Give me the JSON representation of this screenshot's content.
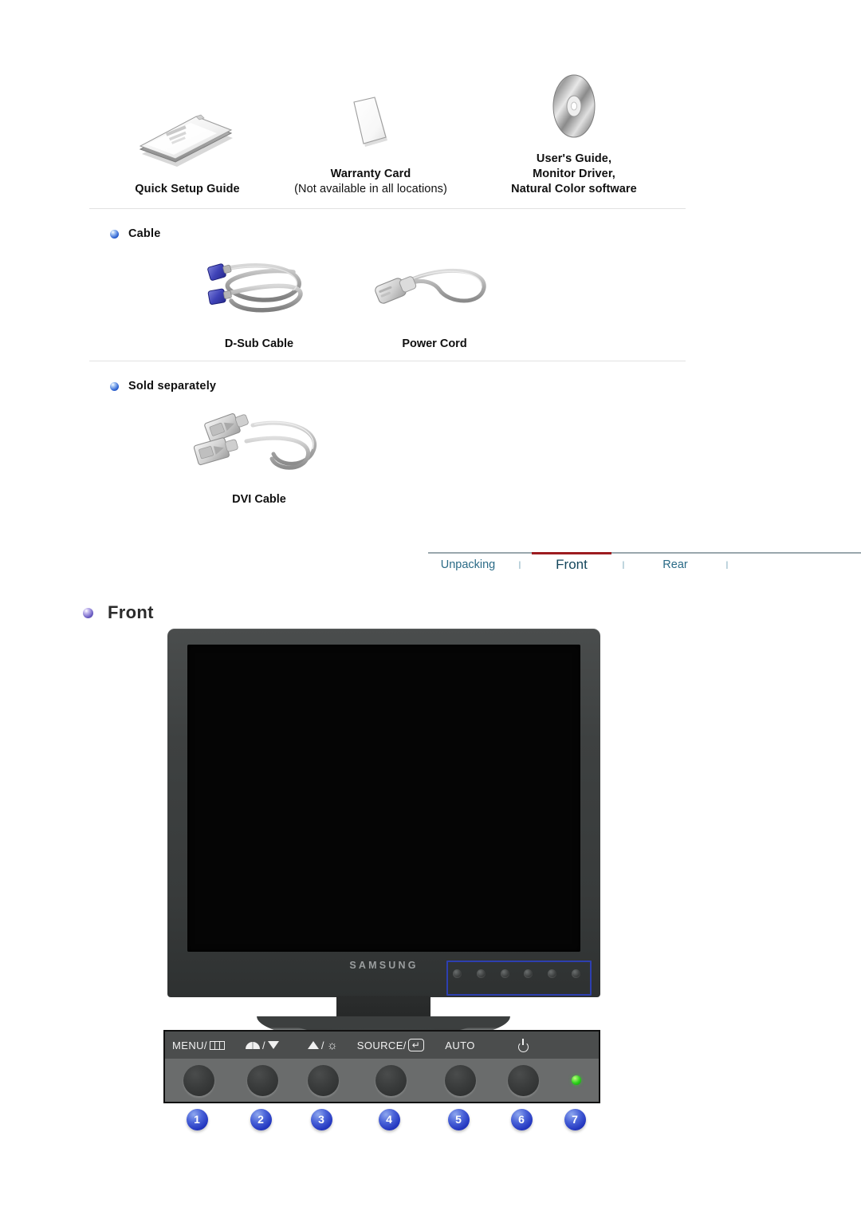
{
  "accessories": {
    "items": [
      {
        "icon": "manual-booklet-icon",
        "caption": "Quick Setup Guide",
        "sub": ""
      },
      {
        "icon": "warranty-card-icon",
        "caption": "Warranty Card",
        "sub": "(Not available in all locations)"
      },
      {
        "icon": "cd-disc-icon",
        "caption": "User's Guide,\nMonitor Driver,\nNatural Color software",
        "sub": ""
      }
    ],
    "item1_caption": "Quick Setup Guide",
    "item2_caption": "Warranty Card",
    "item2_sub": "(Not available in all locations)",
    "item3_line1": "User's Guide,",
    "item3_line2": "Monitor Driver,",
    "item3_line3": "Natural Color software"
  },
  "cable_section": {
    "heading": "Cable",
    "items": [
      {
        "icon": "d-sub-cable-icon",
        "caption": "D-Sub Cable"
      },
      {
        "icon": "power-cord-icon",
        "caption": "Power Cord"
      }
    ],
    "item1_caption": "D-Sub Cable",
    "item2_caption": "Power Cord"
  },
  "sold_separately_section": {
    "heading": "Sold separately",
    "item1_caption": "DVI Cable"
  },
  "tabnav": {
    "tabs": [
      {
        "label": "Unpacking",
        "active": false
      },
      {
        "label": "Front",
        "active": true
      },
      {
        "label": "Rear",
        "active": false
      }
    ],
    "tab1": "Unpacking",
    "tab2": "Front",
    "tab3": "Rear",
    "separator": "l",
    "active_color": "#9d1c20",
    "link_color": "#2b6b87"
  },
  "front_section": {
    "heading": "Front",
    "monitor": {
      "brand_logo": "SAMSUNG",
      "bezel_color": "#3e4141",
      "screen_color": "#050505",
      "highlight_color": "#2d3fb0"
    },
    "control_panel": {
      "buttons": [
        {
          "num": "1",
          "label": "MENU/",
          "icon": "menu-osd-icon"
        },
        {
          "num": "2",
          "label": "",
          "icon": "contrast-icon",
          "icon2": "triangle-down-icon"
        },
        {
          "num": "3",
          "label": "",
          "icon": "triangle-up-icon",
          "icon2": "brightness-sun-icon"
        },
        {
          "num": "4",
          "label": "SOURCE/",
          "icon": "enter-key-icon"
        },
        {
          "num": "5",
          "label": "AUTO",
          "icon": ""
        },
        {
          "num": "6",
          "label": "",
          "icon": "power-icon"
        },
        {
          "num": "7",
          "label": "",
          "icon": "power-led-indicator"
        }
      ],
      "label1": "MENU/",
      "label4": "SOURCE/",
      "label5": "AUTO",
      "enter_glyph": "↵",
      "sun_glyph": "☼",
      "slash": "/",
      "callout_numbers": [
        "1",
        "2",
        "3",
        "4",
        "5",
        "6",
        "7"
      ]
    }
  }
}
